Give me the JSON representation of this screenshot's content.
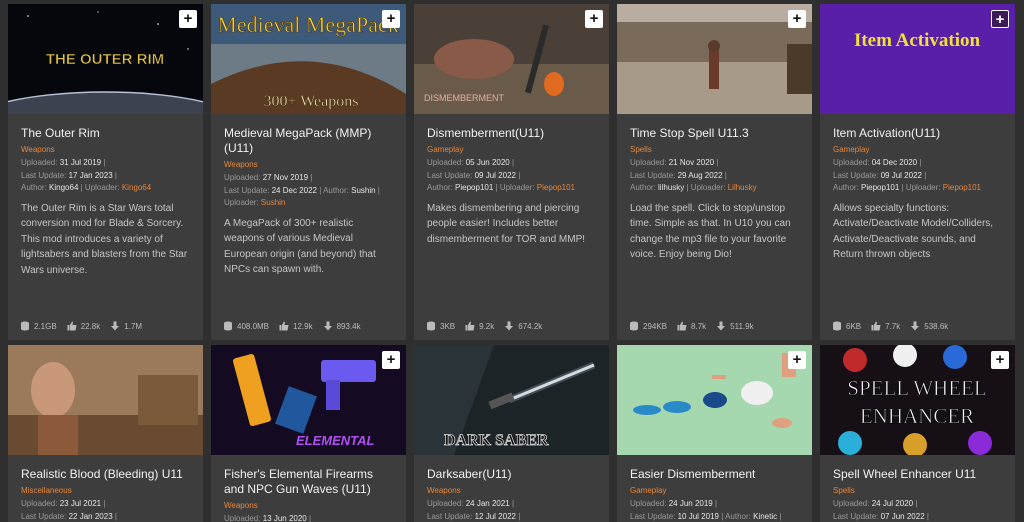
{
  "labels": {
    "uploaded": "Uploaded:",
    "last_update": "Last Update:",
    "author": "Author:",
    "uploader": "Uploader:",
    "add": "+"
  },
  "mods": [
    {
      "title": "The Outer Rim",
      "thumb_text": "THE OUTER RIM",
      "category": "Weapons",
      "uploaded": "31 Jul 2019",
      "last_update": "17 Jan 2023",
      "author": "Kingo64",
      "uploader": "Kingo64",
      "description": "The Outer Rim is a Star Wars total conversion mod for Blade & Sorcery. This mod introduces a variety of lightsabers and blasters from the Star Wars universe.",
      "size": "2.1GB",
      "endorsements": "22.8k",
      "downloads": "1.7M"
    },
    {
      "title": "Medieval MegaPack (MMP) (U11)",
      "thumb_text": "Medieval MegaPack",
      "thumb_sub": "300+ Weapons",
      "category": "Weapons",
      "uploaded": "27 Nov 2019",
      "last_update": "24 Dec 2022",
      "author": "Sushin",
      "uploader": "Sushin",
      "description": "A MegaPack of 300+ realistic weapons of various Medieval European origin (and beyond) that NPCs can spawn with.",
      "size": "408.0MB",
      "endorsements": "12.9k",
      "downloads": "893.4k"
    },
    {
      "title": "Dismemberment(U11)",
      "thumb_text": "DISMEMBERMENT",
      "category": "Gameplay",
      "uploaded": "05 Jun 2020",
      "last_update": "09 Jul 2022",
      "author": "Piepop101",
      "uploader": "Piepop101",
      "description": "Makes dismembering and piercing people easier! Includes better dismemberment for TOR and MMP!",
      "size": "3KB",
      "endorsements": "9.2k",
      "downloads": "674.2k"
    },
    {
      "title": "Time Stop Spell U11.3",
      "category": "Spells",
      "uploaded": "21 Nov 2020",
      "last_update": "29 Aug 2022",
      "author": "lilhusky",
      "uploader": "Lilhusky",
      "description": "Load the spell. Click to stop/unstop time. Simple as that. In U10 you can change the mp3 file to your favorite voice. Enjoy being Dio!",
      "size": "294KB",
      "endorsements": "8.7k",
      "downloads": "511.9k"
    },
    {
      "title": "Item Activation(U11)",
      "thumb_text": "Item Activation",
      "category": "Gameplay",
      "uploaded": "04 Dec 2020",
      "last_update": "09 Jul 2022",
      "author": "Piepop101",
      "uploader": "Piepop101",
      "description": "Allows specialty functions: Activate/Deactivate Model/Colliders, Activate/Deactivate sounds, and Return thrown objects",
      "size": "6KB",
      "endorsements": "7.7k",
      "downloads": "538.6k"
    },
    {
      "title": "Realistic Blood (Bleeding) U11",
      "category": "Miscellaneous",
      "uploaded": "23 Jul 2021",
      "last_update": "22 Jan 2023"
    },
    {
      "title": "Fisher's Elemental Firearms and NPC Gun Waves (U11)",
      "thumb_text": "ELEMENTAL",
      "category": "Weapons",
      "uploaded": "13 Jun 2020"
    },
    {
      "title": "Darksaber(U11)",
      "thumb_text": "DARK SABER",
      "category": "Weapons",
      "uploaded": "24 Jan 2021",
      "last_update": "12 Jul 2022"
    },
    {
      "title": "Easier Dismemberment",
      "category": "Gameplay",
      "uploaded": "24 Jun 2019",
      "last_update": "10 Jul 2019",
      "author": "Kinetic"
    },
    {
      "title": "Spell Wheel Enhancer U11",
      "thumb_text": "SPELL WHEEL",
      "thumb_sub": "ENHANCER",
      "category": "Spells",
      "uploaded": "24 Jul 2020",
      "last_update": "07 Jun 2022"
    }
  ],
  "colors": {
    "background": "#2f2f2f",
    "card": "#3d3d3d",
    "accent": "#e8863a"
  }
}
